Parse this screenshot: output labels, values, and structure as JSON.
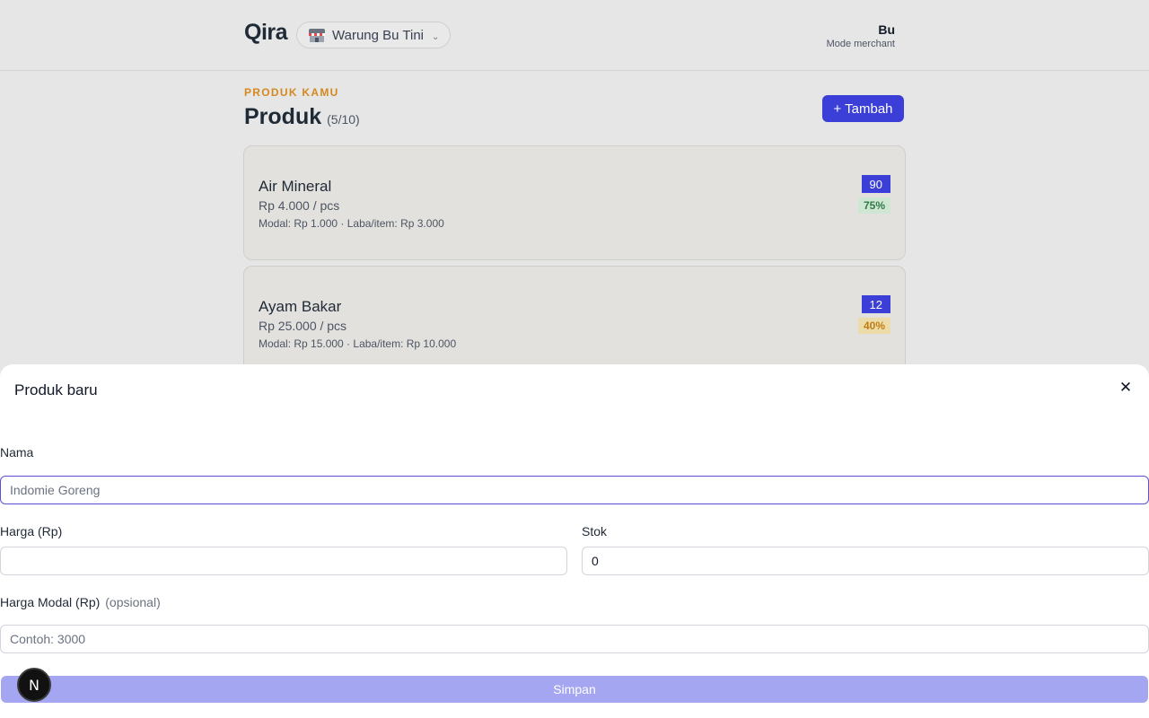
{
  "header": {
    "logo": "Qira",
    "shop_name": "Warung Bu Tini",
    "shop_icon": "shop-icon",
    "chevron": "⌄",
    "user_name": "Bu",
    "user_mode": "Mode merchant"
  },
  "section": {
    "eyebrow": "PRODUK KAMU",
    "title": "Produk",
    "count": "(5/10)",
    "add_label": "+ Tambah"
  },
  "products": [
    {
      "name": "Air Mineral",
      "price": "Rp 4.000 / pcs",
      "meta": "Modal: Rp 1.000 · Laba/item: Rp 3.000",
      "stock": "90",
      "margin": "75%",
      "margin_bg": "#cfe6d3",
      "margin_fg": "#2f7a47"
    },
    {
      "name": "Ayam Bakar",
      "price": "Rp 25.000 / pcs",
      "meta": "Modal: Rp 15.000 · Laba/item: Rp 10.000",
      "stock": "12",
      "margin": "40%",
      "margin_bg": "#ecdcaa",
      "margin_fg": "#c27d12"
    }
  ],
  "sheet": {
    "title": "Produk baru",
    "close": "✕",
    "name_label": "Nama",
    "name_placeholder": "Indomie Goreng",
    "price_label": "Harga (Rp)",
    "price_value": "",
    "stock_label": "Stok",
    "stock_value": "0",
    "cost_label": "Harga Modal (Rp)",
    "cost_optional": "(opsional)",
    "cost_placeholder": "Contoh: 3000",
    "save_label": "Simpan"
  },
  "dev_badge": "N",
  "colors": {
    "accent": "#3b3fd8",
    "eyebrow": "#d4891f",
    "save_disabled": "#a5a6f2"
  }
}
